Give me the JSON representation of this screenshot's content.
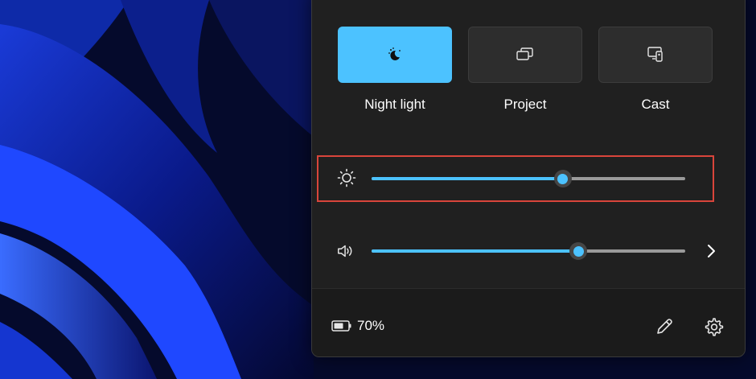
{
  "quick_settings": {
    "tiles": [
      {
        "label": "Night light",
        "icon": "night-light-icon",
        "active": true
      },
      {
        "label": "Project",
        "icon": "project-icon",
        "active": false
      },
      {
        "label": "Cast",
        "icon": "cast-icon",
        "active": false
      }
    ],
    "brightness": {
      "icon": "brightness-icon",
      "level": 0.61
    },
    "volume": {
      "icon": "speaker-icon",
      "level": 0.66,
      "more_icon": "chevron-right-icon"
    },
    "battery": {
      "icon": "battery-icon",
      "percent_label": "70%"
    },
    "footer_icons": [
      "edit-icon",
      "settings-icon"
    ]
  },
  "colors": {
    "accent": "#4cc2ff",
    "panel": "#202020",
    "highlight": "#d9453b"
  }
}
